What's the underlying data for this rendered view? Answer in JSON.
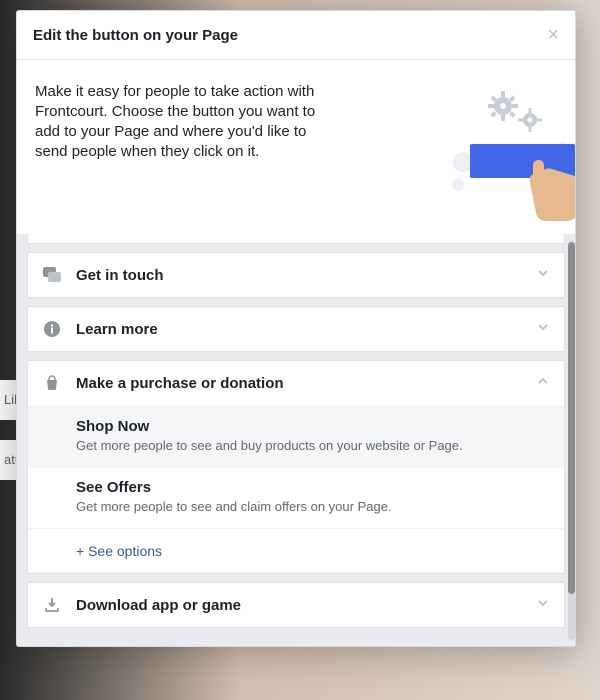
{
  "dialog": {
    "title": "Edit the button on your Page",
    "intro": "Make it easy for people to take action with Frontcourt. Choose the button you want to add to your Page and where you'd like to send people when they click on it."
  },
  "accordion": {
    "get_in_touch": {
      "label": "Get in touch"
    },
    "learn_more": {
      "label": "Learn more"
    },
    "purchase": {
      "label": "Make a purchase or donation",
      "shop_now": {
        "title": "Shop Now",
        "desc": "Get more people to see and buy products on your website or Page."
      },
      "see_offers": {
        "title": "See Offers",
        "desc": "Get more people to see and claim offers on your Page."
      },
      "see_options": "See options"
    },
    "download": {
      "label": "Download app or game"
    }
  }
}
